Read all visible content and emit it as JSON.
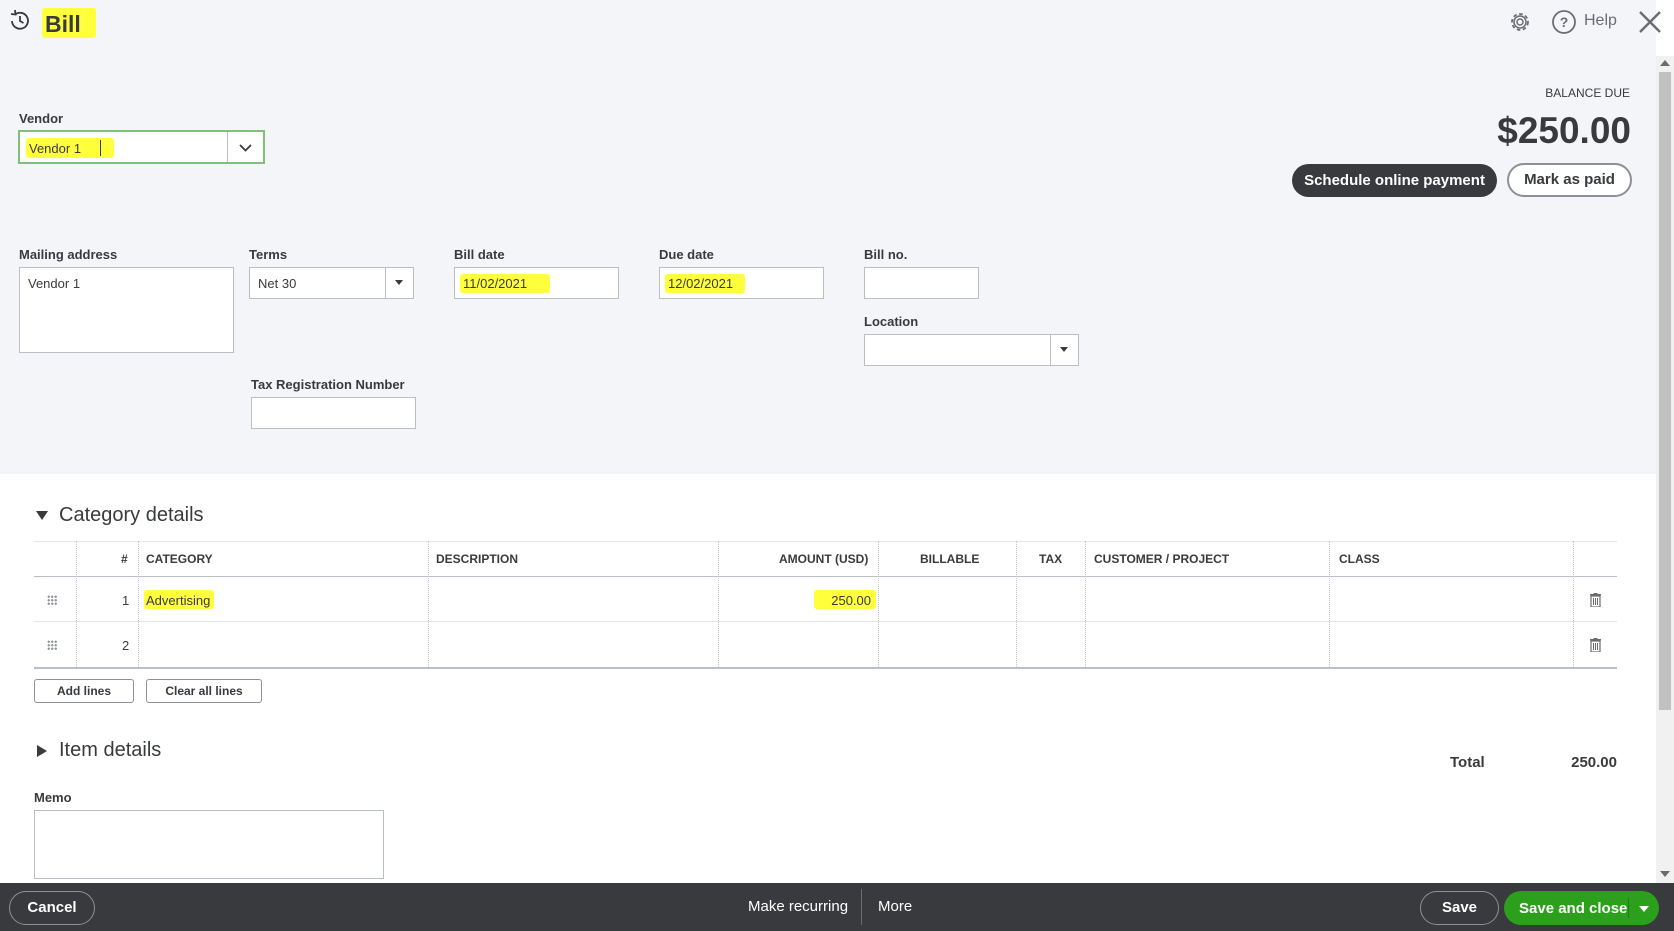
{
  "header": {
    "title": "Bill",
    "help_label": "Help"
  },
  "vendor": {
    "label": "Vendor",
    "value": "Vendor 1"
  },
  "balance": {
    "label": "BALANCE DUE",
    "amount": "$250.00",
    "schedule_label": "Schedule online payment",
    "mark_paid_label": "Mark as paid"
  },
  "mailing": {
    "label": "Mailing address",
    "value": "Vendor 1"
  },
  "terms": {
    "label": "Terms",
    "value": "Net 30"
  },
  "bill_date": {
    "label": "Bill date",
    "value": "11/02/2021"
  },
  "due_date": {
    "label": "Due date",
    "value": "12/02/2021"
  },
  "bill_no": {
    "label": "Bill no.",
    "value": ""
  },
  "location": {
    "label": "Location",
    "value": ""
  },
  "tax_reg": {
    "label": "Tax Registration Number",
    "value": ""
  },
  "category": {
    "title": "Category details",
    "columns": {
      "num": "#",
      "category": "CATEGORY",
      "description": "DESCRIPTION",
      "amount": "AMOUNT (USD)",
      "billable": "BILLABLE",
      "tax": "TAX",
      "customer": "CUSTOMER / PROJECT",
      "class": "CLASS"
    },
    "rows": [
      {
        "num": "1",
        "category": "Advertising",
        "description": "",
        "amount": "250.00"
      },
      {
        "num": "2",
        "category": "",
        "description": "",
        "amount": ""
      }
    ],
    "add_lines_label": "Add lines",
    "clear_lines_label": "Clear all lines"
  },
  "item_details": {
    "title": "Item details"
  },
  "totals": {
    "label": "Total",
    "value": "250.00"
  },
  "memo": {
    "label": "Memo",
    "value": ""
  },
  "footer": {
    "cancel_label": "Cancel",
    "recurring_label": "Make recurring",
    "more_label": "More",
    "save_label": "Save",
    "save_close_label": "Save and close"
  },
  "colors": {
    "accent_green": "#2ca01c",
    "dark": "#393a3d",
    "highlight": "#ffff3b",
    "panel": "#f4f5f8"
  }
}
